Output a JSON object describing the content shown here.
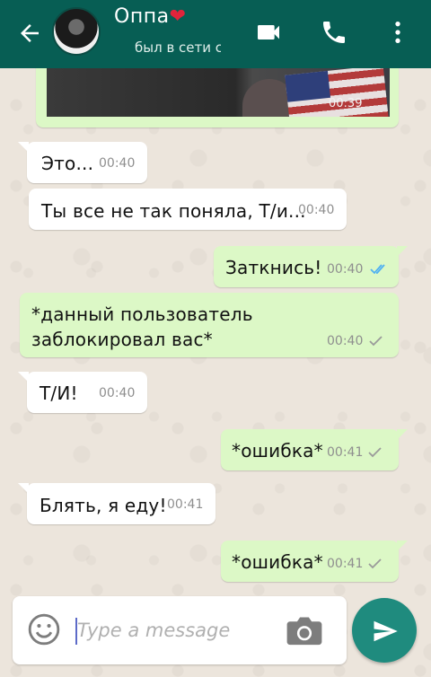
{
  "header": {
    "contact_name": "Оппа",
    "heart": "❤",
    "status": "был в сети сегодня",
    "colors": {
      "bar": "#075e54",
      "heart": "#e0243b"
    },
    "icons": [
      "back-arrow-icon",
      "video-call-icon",
      "phone-icon",
      "more-vertical-icon"
    ]
  },
  "photo_message": {
    "time": "00:39"
  },
  "messages": [
    {
      "direction": "in",
      "text": "Это...",
      "time": "00:40"
    },
    {
      "direction": "in",
      "text": "Ты все не так поняла, Т/и...",
      "time": "00:40"
    },
    {
      "direction": "out",
      "text": "Заткнись!",
      "time": "00:40",
      "status": "read"
    },
    {
      "direction": "out",
      "lines": [
        "*данный пользователь",
        "заблокировал вас*"
      ],
      "time": "00:40",
      "status": "sent"
    },
    {
      "direction": "in",
      "text": "Т/И!",
      "time": "00:40"
    },
    {
      "direction": "out",
      "text": "*ошибка*",
      "time": "00:41",
      "status": "sent"
    },
    {
      "direction": "in",
      "text": "Блять, я еду!",
      "time": "00:41"
    },
    {
      "direction": "out",
      "text": "*ошибка*",
      "time": "00:41",
      "status": "sent"
    }
  ],
  "composer": {
    "placeholder": "Type a message",
    "icons": [
      "emoji-icon",
      "camera-icon",
      "send-icon"
    ],
    "send_color": "#1f8b7e"
  },
  "colors": {
    "outgoing_bubble": "#dcf8c6",
    "incoming_bubble": "#ffffff",
    "read_tick": "#4fb0f2"
  }
}
